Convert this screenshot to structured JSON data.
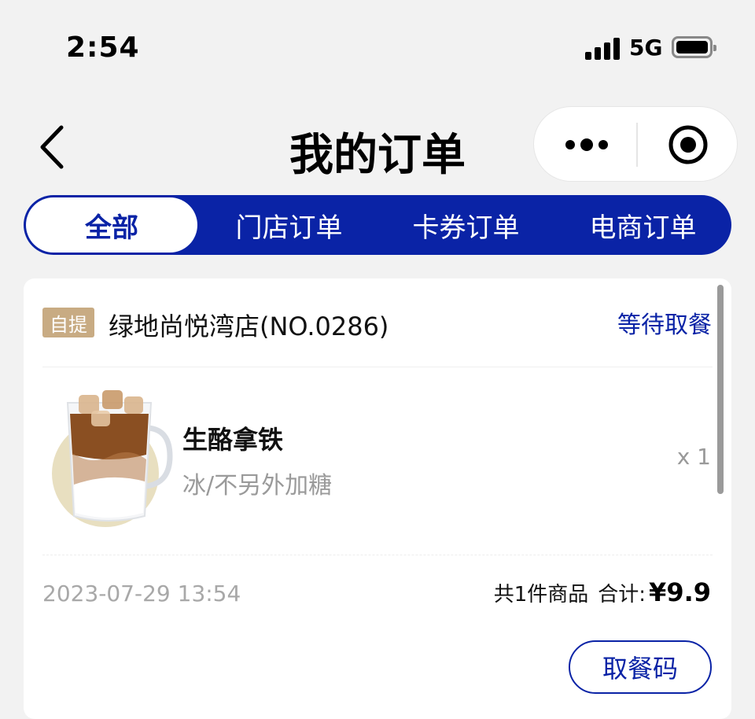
{
  "status_bar": {
    "time": "2:54",
    "network": "5G",
    "battery_level": 0.85
  },
  "nav": {
    "title": "我的订单",
    "back_icon": "chevron-left-icon",
    "more_icon": "more-dots-icon",
    "close_icon": "target-circle-icon"
  },
  "tabs": [
    {
      "label": "全部",
      "active": true
    },
    {
      "label": "门店订单",
      "active": false
    },
    {
      "label": "卡券订单",
      "active": false
    },
    {
      "label": "电商订单",
      "active": false
    }
  ],
  "order": {
    "pickup_badge": "自提",
    "store_name": "绿地尚悦湾店(NO.0286)",
    "status": "等待取餐",
    "item": {
      "name": "生酪拿铁",
      "spec": "冰/不另外加糖",
      "qty": "x 1",
      "image": "iced-latte-image"
    },
    "time": "2023-07-29 13:54",
    "summary_count": "共1件商品",
    "summary_label": "合计:",
    "total": "¥9.9",
    "pickup_button": "取餐码"
  },
  "colors": {
    "brand_blue": "#0a23a6",
    "badge_tan": "#c8ab83",
    "background": "#f2f2f2"
  }
}
